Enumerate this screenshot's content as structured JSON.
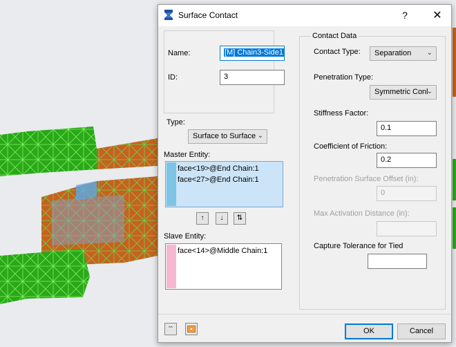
{
  "dialog": {
    "title": "Surface Contact",
    "help_label": "?",
    "close_label": "✕"
  },
  "left": {
    "name_label": "Name:",
    "name_value": "[M] Chain3-Side1",
    "id_label": "ID:",
    "id_value": "3",
    "type_label": "Type:",
    "type_value": "Surface to Surface",
    "master_label": "Master Entity:",
    "master_items": [
      "face<19>@End Chain:1",
      "face<27>@End Chain:1"
    ],
    "master_color": "#7ec4e4",
    "move_up_label": "↑",
    "move_down_label": "↓",
    "swap_label": "⇅",
    "slave_label": "Slave Entity:",
    "slave_items": [
      "face<14>@Middle Chain:1"
    ],
    "slave_color": "#f5b8d0"
  },
  "right": {
    "group_label": "Contact Data",
    "contact_type_label": "Contact Type:",
    "contact_type_value": "Separation",
    "penetration_type_label": "Penetration Type:",
    "penetration_type_value": "Symmetric Conl",
    "stiffness_label": "Stiffness Factor:",
    "stiffness_value": "0.1",
    "friction_label": "Coefficient of Friction:",
    "friction_value": "0.2",
    "pen_offset_label": "Penetration Surface Offset (in):",
    "pen_offset_value": "0",
    "max_activation_label": "Max Activation Distance (in):",
    "max_activation_value": "",
    "capture_label": "Capture Tolerance for Tied",
    "capture_value": ""
  },
  "footer": {
    "ok_label": "OK",
    "cancel_label": "Cancel"
  },
  "icons": {
    "title": "surface-contact-icon",
    "collapse": "double-chevron-up-icon",
    "settings": "orange-settings-icon"
  },
  "colors": {
    "mesh_green": "#2aa81a",
    "mesh_orange": "#c7621e",
    "highlight_blue": "#5aa9e6",
    "accent": "#0078d7"
  }
}
